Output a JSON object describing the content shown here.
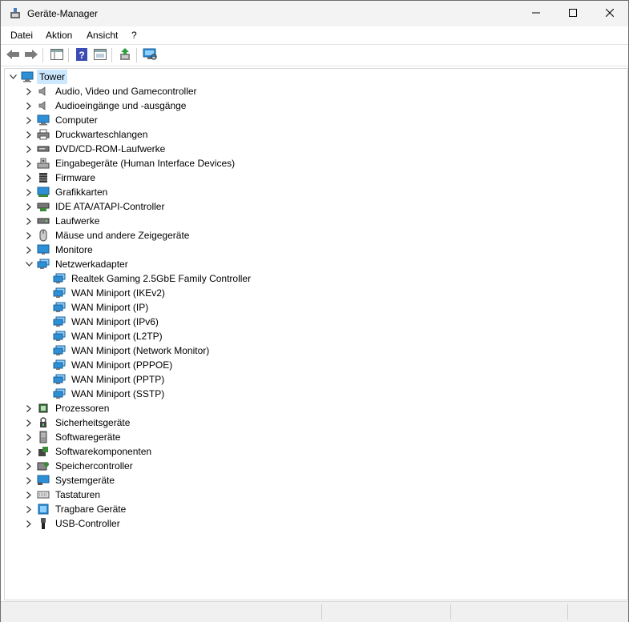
{
  "window": {
    "title": "Geräte-Manager"
  },
  "menu": [
    "Datei",
    "Aktion",
    "Ansicht",
    "?"
  ],
  "toolbar": {
    "buttons": [
      "back-icon",
      "forward-icon",
      "properties-panel-icon",
      "help-icon",
      "view-icon",
      "update-driver-icon",
      "scan-hardware-icon"
    ]
  },
  "tree": {
    "root": "Tower",
    "categories": [
      {
        "label": "Audio, Video und Gamecontroller",
        "icon": "speaker-icon"
      },
      {
        "label": "Audioeingänge und -ausgänge",
        "icon": "speaker-icon"
      },
      {
        "label": "Computer",
        "icon": "computer-icon"
      },
      {
        "label": "Druckwarteschlangen",
        "icon": "printer-icon"
      },
      {
        "label": "DVD/CD-ROM-Laufwerke",
        "icon": "dvd-drive-icon"
      },
      {
        "label": "Eingabegeräte (Human Interface Devices)",
        "icon": "hid-icon"
      },
      {
        "label": "Firmware",
        "icon": "firmware-icon"
      },
      {
        "label": "Grafikkarten",
        "icon": "display-adapter-icon"
      },
      {
        "label": "IDE ATA/ATAPI-Controller",
        "icon": "ide-controller-icon"
      },
      {
        "label": "Laufwerke",
        "icon": "disk-drive-icon"
      },
      {
        "label": "Mäuse und andere Zeigegeräte",
        "icon": "mouse-icon"
      },
      {
        "label": "Monitore",
        "icon": "monitor-icon"
      },
      {
        "label": "Netzwerkadapter",
        "icon": "network-adapter-icon",
        "expanded": true,
        "children": [
          "Realtek Gaming 2.5GbE Family Controller",
          "WAN Miniport (IKEv2)",
          "WAN Miniport (IP)",
          "WAN Miniport (IPv6)",
          "WAN Miniport (L2TP)",
          "WAN Miniport (Network Monitor)",
          "WAN Miniport (PPPOE)",
          "WAN Miniport (PPTP)",
          "WAN Miniport (SSTP)"
        ]
      },
      {
        "label": "Prozessoren",
        "icon": "processor-icon"
      },
      {
        "label": "Sicherheitsgeräte",
        "icon": "security-device-icon"
      },
      {
        "label": "Softwaregeräte",
        "icon": "software-device-icon"
      },
      {
        "label": "Softwarekomponenten",
        "icon": "software-component-icon"
      },
      {
        "label": "Speichercontroller",
        "icon": "storage-controller-icon"
      },
      {
        "label": "Systemgeräte",
        "icon": "system-device-icon"
      },
      {
        "label": "Tastaturen",
        "icon": "keyboard-icon"
      },
      {
        "label": "Tragbare Geräte",
        "icon": "portable-device-icon"
      },
      {
        "label": "USB-Controller",
        "icon": "usb-icon"
      }
    ]
  },
  "colors": {
    "selection": "#cce8ff",
    "network_blue": "#2d8fd6"
  }
}
